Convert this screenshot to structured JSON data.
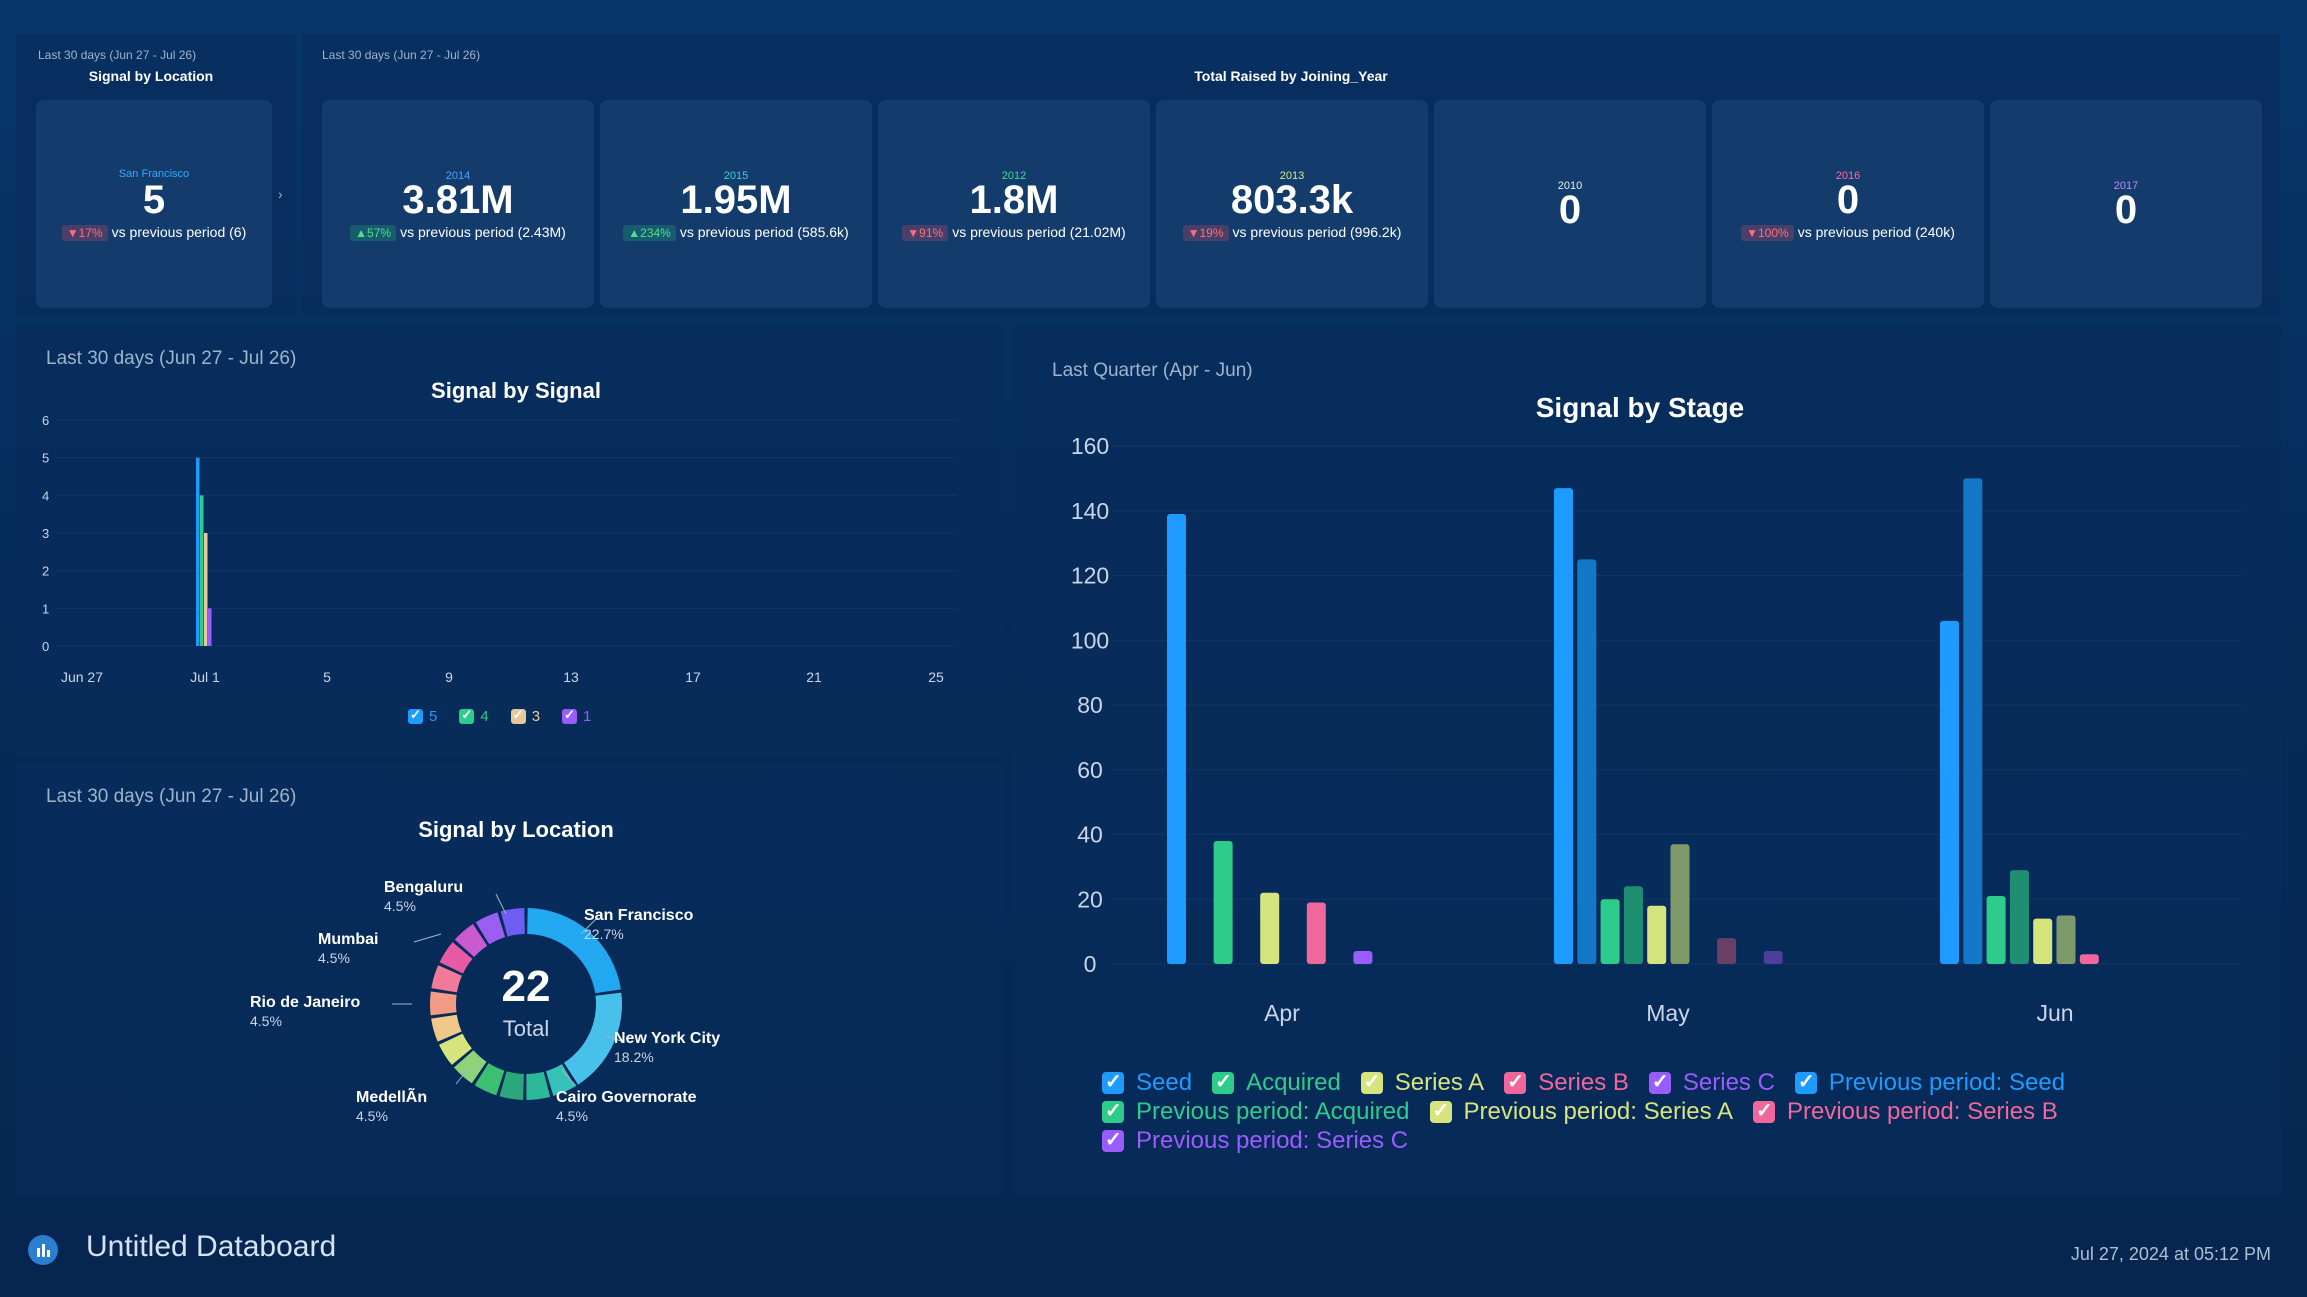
{
  "location_kpi": {
    "period": "Last 30 days (Jun 27 - Jul 26)",
    "title": "Signal by Location",
    "city": "San Francisco",
    "value": "5",
    "delta": "17%",
    "delta_dir": "down",
    "compare": "vs previous period (6)",
    "arrow": "›"
  },
  "raised": {
    "period": "Last 30 days (Jun 27 - Jul 26)",
    "title": "Total Raised by Joining_Year",
    "cards": [
      {
        "year": "2014",
        "value": "3.81M",
        "delta": "57%",
        "dir": "up",
        "compare": "vs previous period (2.43M)",
        "color": "#4aa3ff"
      },
      {
        "year": "2015",
        "value": "1.95M",
        "delta": "234%",
        "dir": "up",
        "compare": "vs previous period (585.6k)",
        "color": "#38d0e0"
      },
      {
        "year": "2012",
        "value": "1.8M",
        "delta": "91%",
        "dir": "down",
        "compare": "vs previous period (21.02M)",
        "color": "#3ddc97"
      },
      {
        "year": "2013",
        "value": "803.3k",
        "delta": "19%",
        "dir": "down",
        "compare": "vs previous period (996.2k)",
        "color": "#d9e78c"
      },
      {
        "year": "2010",
        "value": "0",
        "delta": "",
        "dir": "",
        "compare": "",
        "color": "#e8eef6"
      },
      {
        "year": "2016",
        "value": "0",
        "delta": "100%",
        "dir": "down",
        "compare": "vs previous period (240k)",
        "color": "#ff6b9a"
      },
      {
        "year": "2017",
        "value": "0",
        "delta": "",
        "dir": "",
        "compare": "",
        "color": "#b98aff"
      }
    ]
  },
  "signal_chart": {
    "period": "Last 30 days (Jun 27 - Jul 26)",
    "title": "Signal by Signal"
  },
  "location_chart": {
    "period": "Last 30 days (Jun 27 - Jul 26)",
    "title": "Signal by Location",
    "total": "22",
    "total_label": "Total",
    "labels": [
      {
        "name": "Bengaluru",
        "pct": "4.5%"
      },
      {
        "name": "San Francisco",
        "pct": "22.7%"
      },
      {
        "name": "Mumbai",
        "pct": "4.5%"
      },
      {
        "name": "Rio de Janeiro",
        "pct": "4.5%"
      },
      {
        "name": "New York City",
        "pct": "18.2%"
      },
      {
        "name": "MedellÃn",
        "pct": "4.5%"
      },
      {
        "name": "Cairo Governorate",
        "pct": "4.5%"
      }
    ]
  },
  "stage_chart": {
    "period": "Last Quarter (Apr - Jun)",
    "title": "Signal by Stage"
  },
  "footer": {
    "title": "Untitled Databoard",
    "date": "Jul 27, 2024 at 05:12 PM"
  },
  "chart_data": [
    {
      "type": "bar",
      "title": "Signal by Signal",
      "x_ticks": [
        "Jun 27",
        "Jul 1",
        "5",
        "9",
        "13",
        "17",
        "21",
        "25"
      ],
      "ylim": [
        0,
        6
      ],
      "y_ticks": [
        0,
        1,
        2,
        3,
        4,
        5,
        6
      ],
      "category": "Jul 1",
      "series": [
        {
          "name": "5",
          "value": 5,
          "color": "#1e9bff"
        },
        {
          "name": "4",
          "value": 4,
          "color": "#2ecc8a"
        },
        {
          "name": "3",
          "value": 3,
          "color": "#e6c89a"
        },
        {
          "name": "1",
          "value": 1,
          "color": "#9b5cff"
        }
      ],
      "legend_position": "bottom"
    },
    {
      "type": "pie",
      "title": "Signal by Location",
      "total": 22,
      "slices": [
        {
          "name": "San Francisco",
          "value": 22.7,
          "color": "#22a8f0"
        },
        {
          "name": "New York City",
          "value": 18.2,
          "color": "#48c0ec"
        },
        {
          "name": "Cairo Governorate",
          "value": 4.5,
          "color": "#36c2b8"
        },
        {
          "name": "",
          "value": 4.5,
          "color": "#2eb89a"
        },
        {
          "name": "",
          "value": 4.5,
          "color": "#2aa87c"
        },
        {
          "name": "MedellÃn",
          "value": 4.5,
          "color": "#3cbf72"
        },
        {
          "name": "",
          "value": 4.5,
          "color": "#8ed37a"
        },
        {
          "name": "",
          "value": 4.5,
          "color": "#d6e47e"
        },
        {
          "name": "Rio de Janeiro",
          "value": 4.5,
          "color": "#f0c98a"
        },
        {
          "name": "",
          "value": 4.5,
          "color": "#f39b84"
        },
        {
          "name": "Mumbai",
          "value": 4.5,
          "color": "#f07a98"
        },
        {
          "name": "",
          "value": 4.5,
          "color": "#e65aa6"
        },
        {
          "name": "",
          "value": 4.5,
          "color": "#c95ad0"
        },
        {
          "name": "Bengaluru",
          "value": 4.5,
          "color": "#9a5ef0"
        },
        {
          "name": "",
          "value": 4.5,
          "color": "#6f5cf2"
        }
      ]
    },
    {
      "type": "bar",
      "title": "Signal by Stage",
      "categories": [
        "Apr",
        "May",
        "Jun"
      ],
      "ylim": [
        0,
        160
      ],
      "y_ticks": [
        0,
        20,
        40,
        60,
        80,
        100,
        120,
        140,
        160
      ],
      "series": [
        {
          "name": "Seed",
          "values": [
            139,
            147,
            106
          ],
          "color": "#1e9bff"
        },
        {
          "name": "Previous period: Seed",
          "values": [
            null,
            125,
            150
          ],
          "color": "#1478c8"
        },
        {
          "name": "Acquired",
          "values": [
            38,
            20,
            21
          ],
          "color": "#2ecc8a"
        },
        {
          "name": "Previous period: Acquired",
          "values": [
            null,
            24,
            29
          ],
          "color": "#1f8f72"
        },
        {
          "name": "Series A",
          "values": [
            22,
            18,
            14
          ],
          "color": "#d6e47e"
        },
        {
          "name": "Previous period: Series A",
          "values": [
            null,
            37,
            15
          ],
          "color": "#7f9a6a"
        },
        {
          "name": "Series B",
          "values": [
            19,
            null,
            3
          ],
          "color": "#f0679b"
        },
        {
          "name": "Previous period: Series B",
          "values": [
            null,
            8,
            null
          ],
          "color": "#6a3f66"
        },
        {
          "name": "Series C",
          "values": [
            4,
            null,
            null
          ],
          "color": "#9b5cff"
        },
        {
          "name": "Previous period: Series C",
          "values": [
            null,
            4,
            null
          ],
          "color": "#4d3f9a"
        }
      ],
      "legend": [
        {
          "name": "Seed",
          "color": "#1e9bff"
        },
        {
          "name": "Acquired",
          "color": "#2ecc8a"
        },
        {
          "name": "Series A",
          "color": "#d6e47e"
        },
        {
          "name": "Series B",
          "color": "#f0679b"
        },
        {
          "name": "Series C",
          "color": "#9b5cff"
        },
        {
          "name": "Previous period: Seed",
          "color": "#1e9bff"
        },
        {
          "name": "Previous period: Acquired",
          "color": "#2ecc8a"
        },
        {
          "name": "Previous period: Series A",
          "color": "#d6e47e"
        },
        {
          "name": "Previous period: Series B",
          "color": "#f0679b"
        },
        {
          "name": "Previous period: Series C",
          "color": "#9b5cff"
        }
      ],
      "legend_position": "bottom"
    }
  ]
}
